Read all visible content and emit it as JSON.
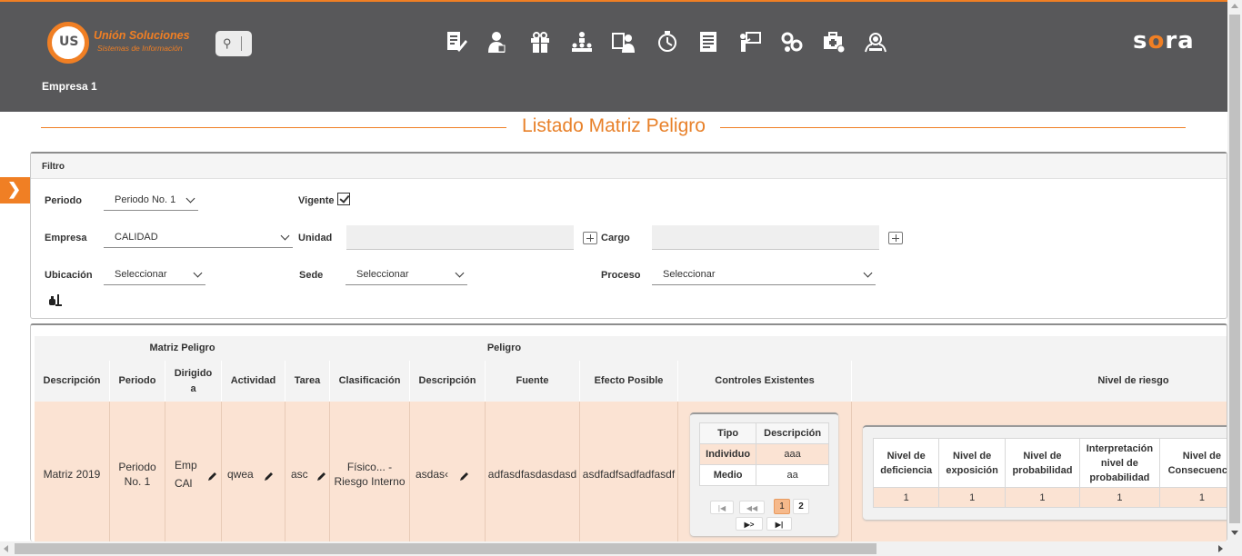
{
  "header": {
    "logo_name": "Unión Soluciones",
    "logo_tagline": "Sistemas de Información",
    "logo_mark": "US",
    "brand_left": "s",
    "brand_accent": "o",
    "brand_right": "ra",
    "company": "Empresa 1",
    "nav_icons": [
      "document-edit-icon",
      "user-person-icon",
      "gift-icon",
      "hierarchy-icon",
      "user-card-icon",
      "timer-icon",
      "report-list-icon",
      "training-board-icon",
      "gears-icon",
      "medical-case-icon",
      "group-search-icon"
    ]
  },
  "page": {
    "title": "Listado Matriz Peligro"
  },
  "filter": {
    "heading": "Filtro",
    "periodo_label": "Periodo",
    "periodo_value": "Periodo No. 1",
    "vigente_label": "Vigente",
    "vigente_checked": true,
    "empresa_label": "Empresa",
    "empresa_value": "CALIDAD",
    "unidad_label": "Unidad",
    "cargo_label": "Cargo",
    "ubicacion_label": "Ubicación",
    "ubicacion_value": "Seleccionar",
    "sede_label": "Sede",
    "sede_value": "Seleccionar",
    "proceso_label": "Proceso",
    "proceso_value": "Seleccionar"
  },
  "table": {
    "groups": {
      "matriz": "Matriz Peligro",
      "peligro": "Peligro"
    },
    "columns": {
      "descripcion": "Descripción",
      "periodo": "Periodo",
      "dirigido": "Dirigido a",
      "actividad": "Actividad",
      "tarea": "Tarea",
      "clasificacion": "Clasificación",
      "peligro_descripcion": "Descripción",
      "fuente": "Fuente",
      "efecto": "Efecto Posible",
      "controles": "Controles Existentes",
      "nivel_riesgo": "Nivel de riesgo"
    },
    "row": {
      "descripcion": "Matriz 2019",
      "periodo": "Periodo No. 1",
      "dirigido_1": "Emp",
      "dirigido_2": "CAl",
      "actividad": "qwea",
      "tarea": "asc",
      "clasificacion": "Físico... - Riesgo Interno",
      "peligro_descripcion": "asdas‹",
      "fuente": "adfasdfasdasdasd",
      "efecto": "asdfadfsadfadfasdf"
    },
    "controles": {
      "headers": [
        "Tipo",
        "Descripción"
      ],
      "rows": [
        {
          "tipo": "Individuo",
          "descripcion": "aaa"
        },
        {
          "tipo": "Medio",
          "descripcion": "aa"
        }
      ],
      "pager": {
        "first": "|◀",
        "prev": "◀◀",
        "pages": [
          "1",
          "2"
        ],
        "next": "▶>",
        "last": "▶|"
      }
    },
    "riesgo": {
      "headers": [
        "Nivel de deficiencia",
        "Nivel de exposición",
        "Nivel de probabilidad",
        "Interpretación nivel de probabilidad",
        "Nivel de Consecuencia"
      ],
      "values": [
        "1",
        "1",
        "1",
        "1",
        "1"
      ]
    }
  }
}
